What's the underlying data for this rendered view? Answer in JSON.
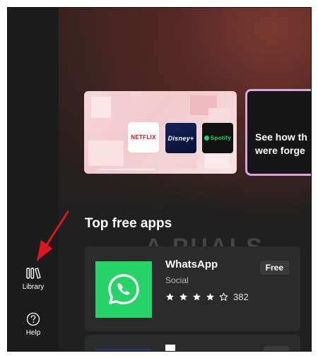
{
  "sidebar": {
    "items": [
      {
        "label": "Library",
        "icon": "library-icon"
      },
      {
        "label": "Help",
        "icon": "help-icon"
      }
    ]
  },
  "hero": {
    "card1": {
      "tiles": [
        "NETFLIX",
        "Disney+",
        "Spotify"
      ]
    },
    "card2": {
      "text_line1": "See how th",
      "text_line2": "were forge"
    }
  },
  "section": {
    "title": "Top free apps"
  },
  "watermark": {
    "text": "A PUALS"
  },
  "apps": [
    {
      "name": "WhatsApp",
      "category": "Social",
      "rating": 4,
      "rating_max": 5,
      "rating_count": "382",
      "price": "Free"
    }
  ],
  "colors": {
    "accent_arrow": "#e0141e",
    "whatsapp_green": "#25d366",
    "card2_border": "#d7a4dc"
  }
}
